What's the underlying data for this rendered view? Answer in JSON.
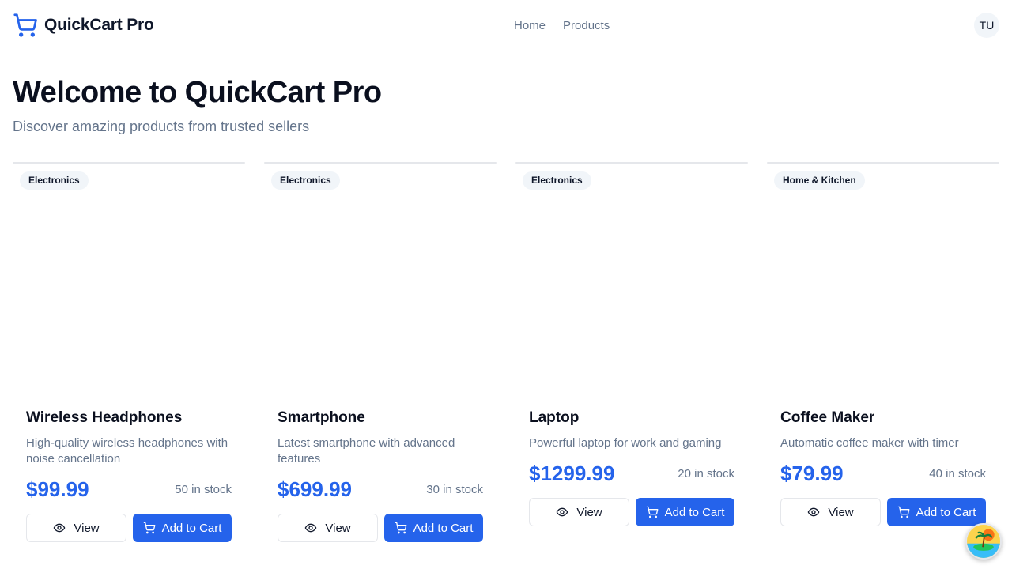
{
  "header": {
    "brand": "QuickCart Pro",
    "nav": [
      "Home",
      "Products"
    ],
    "avatar_initials": "TU"
  },
  "hero": {
    "title": "Welcome to QuickCart Pro",
    "subtitle": "Discover amazing products from trusted sellers"
  },
  "products": [
    {
      "category": "Electronics",
      "name": "Wireless Headphones",
      "description": "High-quality wireless headphones with noise cancellation",
      "price": "$99.99",
      "stock": "50 in stock",
      "view_label": "View",
      "cart_label": "Add to Cart"
    },
    {
      "category": "Electronics",
      "name": "Smartphone",
      "description": "Latest smartphone with advanced features",
      "price": "$699.99",
      "stock": "30 in stock",
      "view_label": "View",
      "cart_label": "Add to Cart"
    },
    {
      "category": "Electronics",
      "name": "Laptop",
      "description": "Powerful laptop for work and gaming",
      "price": "$1299.99",
      "stock": "20 in stock",
      "view_label": "View",
      "cart_label": "Add to Cart"
    },
    {
      "category": "Home & Kitchen",
      "name": "Coffee Maker",
      "description": "Automatic coffee maker with timer",
      "price": "$79.99",
      "stock": "40 in stock",
      "view_label": "View",
      "cart_label": "Add to Cart"
    }
  ],
  "icons": {
    "brand": "shopping-cart-icon",
    "view": "eye-icon",
    "cart": "shopping-cart-icon",
    "fab": "beach-island-icon"
  },
  "colors": {
    "accent": "#2563eb",
    "muted_text": "#64748b",
    "border": "#e5e7eb"
  }
}
